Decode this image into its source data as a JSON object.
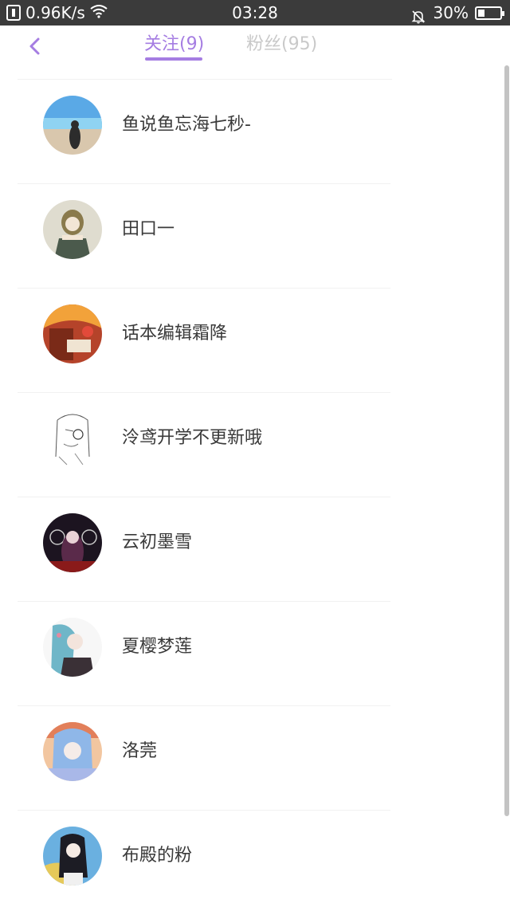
{
  "status_bar": {
    "speed": "0.96K/s",
    "time": "03:28",
    "battery": "30%",
    "battery_level": 0.3,
    "icons": [
      "network-speed-icon",
      "wifi-icon",
      "bell-off-icon",
      "battery-icon"
    ]
  },
  "header": {
    "back_icon": "chevron-left-icon",
    "tabs": [
      {
        "label": "关注(9)",
        "active": true
      },
      {
        "label": "粉丝(95)",
        "active": false
      }
    ]
  },
  "colors": {
    "accent": "#a57de2",
    "inactive_tab": "#c9c9c9",
    "status_bar": "#3b3b3b",
    "text": "#3a3a3a"
  },
  "following": [
    {
      "name": "鱼说鱼忘海七秒-"
    },
    {
      "name": "田口一"
    },
    {
      "name": "话本编辑霜降"
    },
    {
      "name": "泠鸢开学不更新哦"
    },
    {
      "name": "云初墨雪"
    },
    {
      "name": "夏樱梦莲"
    },
    {
      "name": "洛莞"
    },
    {
      "name": "布殿的粉"
    }
  ]
}
